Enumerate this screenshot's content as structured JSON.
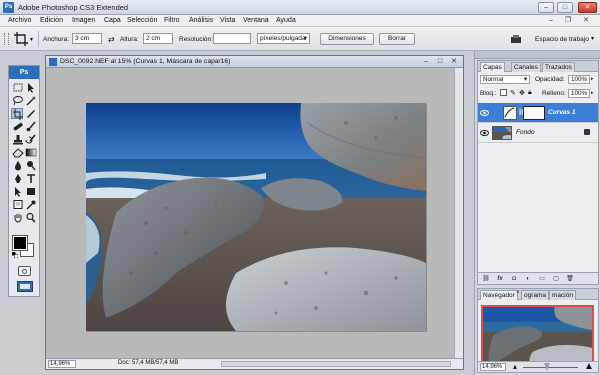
{
  "titlebar": {
    "app_badge": "Ps",
    "title": "Adobe Photoshop CS3 Extended"
  },
  "menubar": {
    "items": [
      "Archivo",
      "Edición",
      "Imagen",
      "Capa",
      "Selección",
      "Filtro",
      "Análisis",
      "Vista",
      "Ventana",
      "Ayuda"
    ]
  },
  "options": {
    "width_label": "Anchura:",
    "width_value": "3 cm",
    "height_label": "Altura:",
    "height_value": "2 cm",
    "resolution_label": "Resolución:",
    "resolution_value": "",
    "resolution_unit": "píxeles/pulgada",
    "dimensions_button": "Dimensiones",
    "clear_button": "Borrar",
    "workspace_label": "Espacio de trabajo"
  },
  "toolbox": {
    "badge": "Ps"
  },
  "document": {
    "title": "DSC_0092.NEF al 15% (Curvas 1, Máscara de capa/16)",
    "zoom": "14,96%",
    "info": "Doc: 57,4 MB/57,4 MB"
  },
  "layers_panel": {
    "tabs": [
      "Capas",
      "Canales",
      "Trazados"
    ],
    "blend_mode": "Normal",
    "opacity_label": "Opacidad:",
    "opacity_value": "100%",
    "lock_label": "Bloq.:",
    "fill_label": "Relleno:",
    "fill_value": "100%",
    "layers": [
      {
        "name": "Curvas 1",
        "selected": true
      },
      {
        "name": "Fondo",
        "selected": false
      }
    ]
  },
  "navigator_panel": {
    "tabs": [
      "Navegador",
      "ograma",
      "mación"
    ],
    "zoom": "14,96%"
  },
  "colors": {
    "selection": "#3d7fd8",
    "ps_blue": "#2c6fb8"
  }
}
